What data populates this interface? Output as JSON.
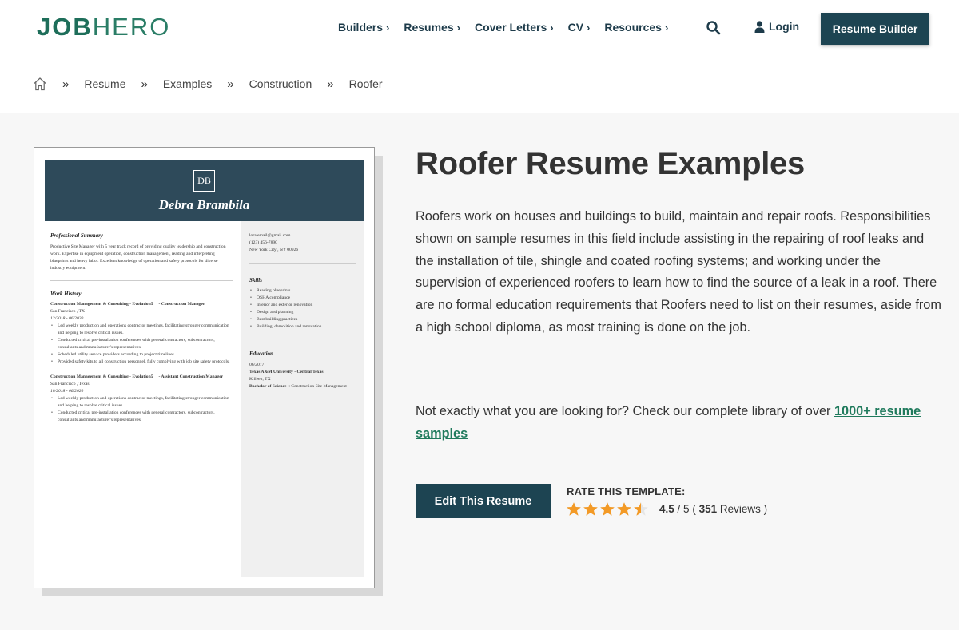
{
  "logo": {
    "bold": "JOB",
    "light": "HERO"
  },
  "nav": [
    {
      "label": "Builders",
      "chevron": "›"
    },
    {
      "label": "Resumes",
      "chevron": "›"
    },
    {
      "label": "Cover Letters",
      "chevron": "›"
    },
    {
      "label": "CV",
      "chevron": "›"
    },
    {
      "label": "Resources",
      "chevron": "›"
    }
  ],
  "header": {
    "login_label": "Login",
    "builder_label": "Resume Builder"
  },
  "breadcrumb": {
    "sep": "»",
    "items": [
      "Resume",
      "Examples",
      "Construction",
      "Roofer"
    ]
  },
  "resume": {
    "monogram": "DB",
    "name": "Debra  Brambila",
    "summary_heading": "Professional Summary",
    "summary": "Productive Site Manager with 5 year track record of providing quality leadership and construction work. Expertise in equipment operation, construction management, reading and interpreting blueprints and heavy labor. Excellent knowledge of operation and safety protocols for diverse industry equipment.",
    "work_heading": "Work History",
    "jobs": [
      {
        "company": "Construction Management & Consulting - Evolution5",
        "role": "- Construction Manager",
        "location": "San Francisco  , TX",
        "dates": "12/2018 - 06/2020",
        "bullets": [
          "Led weekly production and operations contractor meetings, facilitating stronger communication and helping to resolve critical issues.",
          "Conducted critical pre-installation conferences with general contractors, subcontractors, consultants and manufacturer's representatives.",
          "Scheduled utility service providers according to project timelines.",
          "Provided safety kits to all construction personnel, fully complying with job site safety protocols."
        ]
      },
      {
        "company": "Construction Management & Consulting - Evolution5",
        "role": "- Assistant Construction Manager",
        "location": "San Francisco  , Texas",
        "dates": "10/2018 - 06/2020",
        "bullets": [
          "Led weekly production and operations contractor meetings, facilitating stronger communication and helping to resolve critical issues.",
          "Conducted critical pre-installation conferences with general contractors, subcontractors, consultants and manufacturer's representatives."
        ]
      }
    ],
    "contact": {
      "email": "lora.email@gmail.com",
      "phone": "(123) 456-7890",
      "city": "New York City  , NY 00926"
    },
    "skills_heading": "Skills",
    "skills": [
      "Reading blueprints",
      "OSHA compliance",
      "Interior and exterior renovation",
      "Design and planning",
      "Best building practices",
      "Building, demolition and renovation"
    ],
    "education_heading": "Education",
    "education": {
      "date": "06/2017",
      "school": "Texas A&M University - Central Texas",
      "location": "Killeen,  TX",
      "degree": "Bachelor of Science",
      "field": ": Construction Site Management"
    }
  },
  "content": {
    "title": "Roofer Resume Examples",
    "description": "Roofers work on houses and buildings to build, maintain and repair roofs. Responsibilities shown on sample resumes in this field include assisting in the repairing of roof leaks and the installation of tile, shingle and coated roofing systems; and working under the supervision of experienced roofers to learn how to find the source of a leak in a roof. There are no formal education requirements that Roofers need to list on their resumes, aside from a high school diploma, as most training is done on the job.",
    "more_text": "Not exactly what you are looking for? Check our complete library of over ",
    "more_link": "1000+ resume samples",
    "edit_label": "Edit This Resume",
    "rate_label": "RATE THIS TEMPLATE:",
    "rating_value": 4.5,
    "rating_score": "4.5",
    "rating_max": "/ 5",
    "review_count": "351",
    "reviews_word": "Reviews",
    "paren_open": "(",
    "paren_close": ")"
  },
  "colors": {
    "brand_green": "#1e6e5a",
    "navy": "#1d4452",
    "resume_header": "#2e4a5a",
    "star": "#f39a26",
    "link": "#1f7a5c"
  }
}
